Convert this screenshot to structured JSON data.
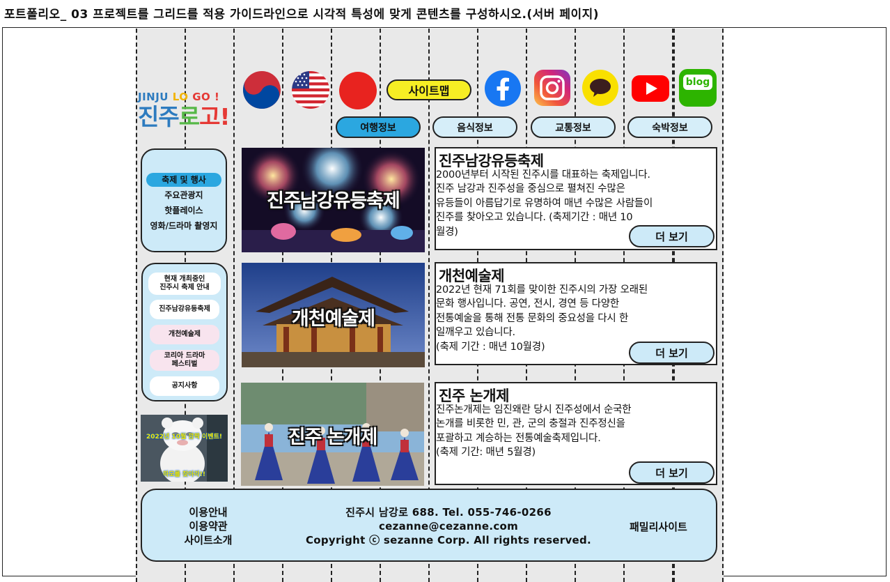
{
  "page_heading": "포트폴리오_ 03 프로젝트를 그리드를 적용 가이드라인으로 시각적 특성에 맞게 콘텐츠를 구성하시오.(서버 페이지)",
  "logo": {
    "top_parts": [
      "JINJU ",
      "LO ",
      "GO !"
    ],
    "bottom_parts": [
      "진주",
      "로",
      "고!"
    ]
  },
  "top_icons": [
    "korean-flag-icon",
    "us-flag-icon",
    "japan-flag-icon",
    "facebook-icon",
    "instagram-icon",
    "kakaotalk-icon",
    "youtube-icon",
    "blog-icon"
  ],
  "blog_label": "blog",
  "sitemap_label": "사이트맵",
  "nav": [
    {
      "label": "여행정보",
      "active": true
    },
    {
      "label": "음식정보",
      "active": false
    },
    {
      "label": "교통정보",
      "active": false
    },
    {
      "label": "숙박정보",
      "active": false
    }
  ],
  "side_menu": [
    {
      "label": "축제 및 행사",
      "active": true
    },
    {
      "label": "주요관광지",
      "active": false
    },
    {
      "label": "핫플레이스",
      "active": false
    },
    {
      "label": "영화/드라마 촬영지",
      "active": false
    }
  ],
  "current_festivals": {
    "heading": [
      "현재 개최중인",
      "진주시 축제 안내"
    ],
    "items": [
      {
        "lines": [
          "진주남강유등축제"
        ],
        "bg": "#ffffff"
      },
      {
        "lines": [
          "개천예술제"
        ],
        "bg": "#f8e4ee"
      },
      {
        "lines": [
          "코리아 드라마",
          "페스티벌"
        ],
        "bg": "#f8e4ee"
      },
      {
        "lines": [
          "공지사항"
        ],
        "bg": "#ffffff"
      }
    ]
  },
  "promo": {
    "line1": "2022년 10월 깜짝 이벤트!",
    "line2": "하모를 찾아라!!"
  },
  "festivals": [
    {
      "image_title": "진주남강유등축제",
      "title": "진주남강유등축제",
      "body_lines": [
        "2000년부터 시작된 진주시를 대표하는 축제입니다.",
        "진주 남강과 진주성을 중심으로 펼쳐진 수많은",
        "유등들이 아름답기로 유명하여 매년 수많은 사람들이",
        "진주를 찾아오고 있습니다. (축제기간 : 매년 10",
        "월경)"
      ],
      "more_label": "더 보기"
    },
    {
      "image_title": "개천예술제",
      "title": "개천예술제",
      "body_lines": [
        "2022년 현재 71회를 맞이한 진주시의 가장 오래된",
        "문화 행사입니다. 공연, 전시, 경연 등 다양한",
        "전통예술을 통해 전통 문화의 중요성을 다시 한",
        "일깨우고 있습니다.",
        "(축제 기간 : 매년 10월경)"
      ],
      "more_label": "더 보기"
    },
    {
      "image_title": "진주 논개제",
      "title": "진주 논개제",
      "body_lines": [
        "진주논개제는 임진왜란 당시 진주성에서 순국한",
        "논개를 비롯한 민, 관, 군의 충절과 진주정신을",
        "포괄하고 계승하는 전통예술축제입니다.",
        "(축제 기간: 매년 5월경)"
      ],
      "more_label": "더 보기"
    }
  ],
  "footer": {
    "links": [
      "이용안내",
      "이용약관",
      "사이트소개"
    ],
    "info": [
      "진주시 남강로 688. Tel. 055-746-0266",
      "cezanne@cezanne.com",
      "Copyright ⓒ sezanne Corp. All rights reserved."
    ],
    "family_site": "패밀리사이트"
  }
}
